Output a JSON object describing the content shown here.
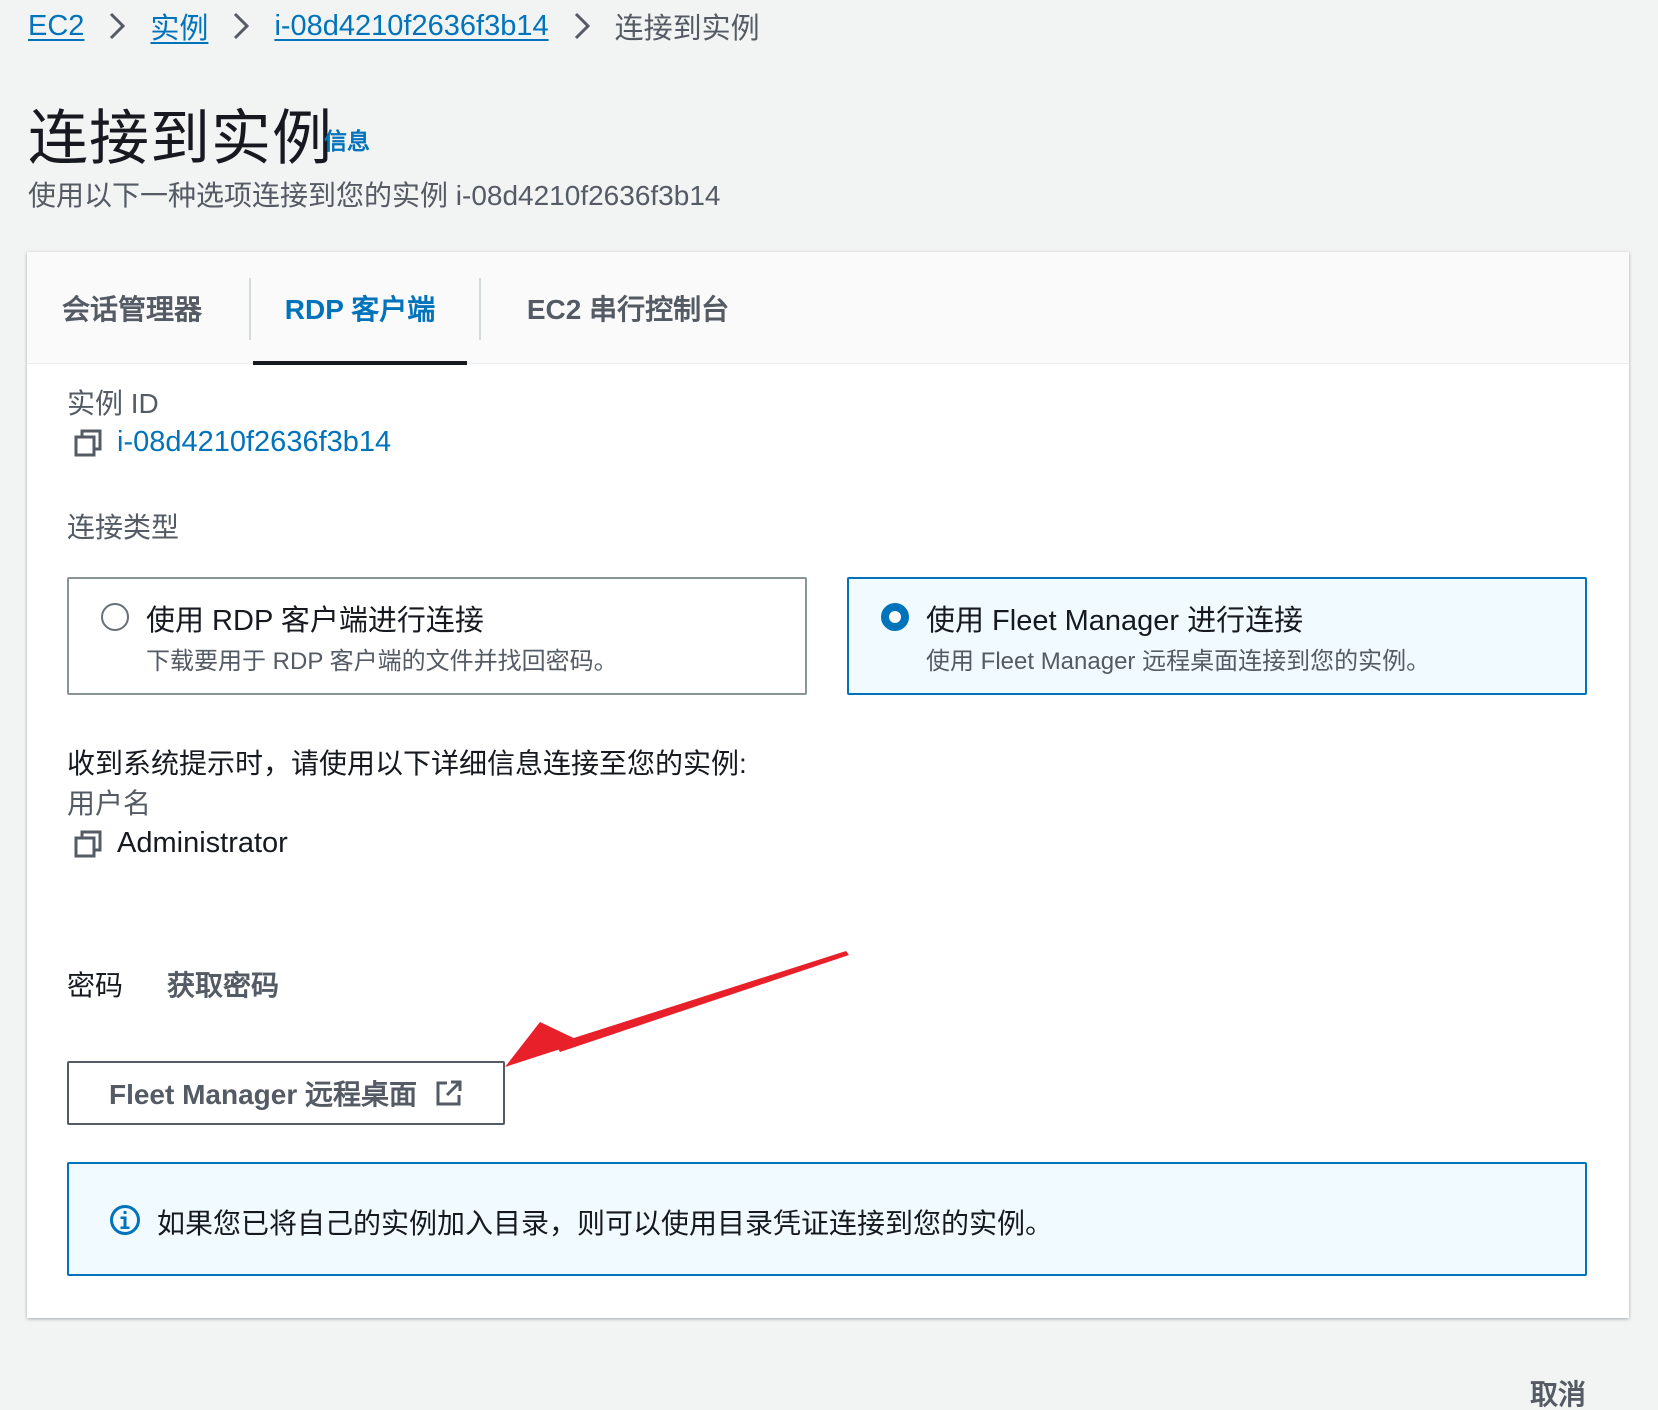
{
  "breadcrumb": {
    "items": [
      "EC2",
      "实例",
      "i-08d4210f2636f3b14"
    ],
    "current": "连接到实例"
  },
  "header": {
    "title": "连接到实例",
    "info_link": "信息",
    "subtitle": "使用以下一种选项连接到您的实例 i-08d4210f2636f3b14"
  },
  "tabs": [
    {
      "label": "会话管理器",
      "active": false
    },
    {
      "label": "RDP 客户端",
      "active": true
    },
    {
      "label": "EC2 串行控制台",
      "active": false
    }
  ],
  "instance": {
    "label": "实例 ID",
    "id": "i-08d4210f2636f3b14"
  },
  "connection_type": {
    "label": "连接类型",
    "options": [
      {
        "title": "使用 RDP 客户端进行连接",
        "description": "下载要用于 RDP 客户端的文件并找回密码。",
        "selected": false
      },
      {
        "title": "使用 Fleet Manager 进行连接",
        "description": "使用 Fleet Manager 远程桌面连接到您的实例。",
        "selected": true
      }
    ]
  },
  "instructions": "收到系统提示时，请使用以下详细信息连接至您的实例:",
  "username": {
    "label": "用户名",
    "value": "Administrator"
  },
  "password": {
    "label": "密码",
    "action": "获取密码"
  },
  "fleet_manager_button": "Fleet Manager 远程桌面",
  "alert": {
    "text": "如果您已将自己的实例加入目录，则可以使用目录凭证连接到您的实例。"
  },
  "footer": {
    "cancel": "取消"
  },
  "colors": {
    "link": "#0073bb",
    "annotation_arrow": "#e8202a",
    "selected_bg": "#f1faff"
  },
  "icons": [
    "chevron-right-icon",
    "copy-icon",
    "external-link-icon",
    "info-circle-icon"
  ]
}
